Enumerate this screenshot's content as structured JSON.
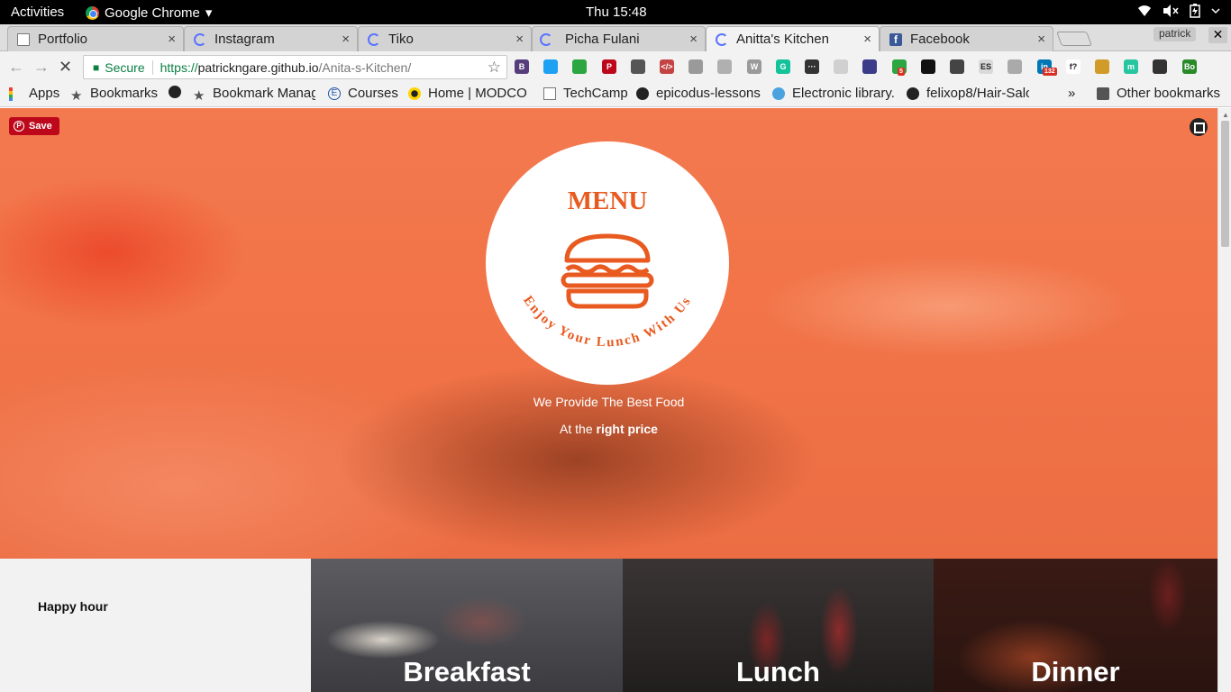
{
  "system_bar": {
    "activities": "Activities",
    "app_name": "Google Chrome",
    "app_menu_arrow": "▾",
    "clock": "Thu 15:48",
    "tray_icons": [
      "wifi-icon",
      "volume-muted-icon",
      "battery-icon",
      "power-menu-icon"
    ]
  },
  "tabs": [
    {
      "label": "Portfolio",
      "icon": "doc"
    },
    {
      "label": "Instagram",
      "icon": "spin"
    },
    {
      "label": "Tiko",
      "icon": "spin"
    },
    {
      "label": "Picha Fulani",
      "icon": "spin"
    },
    {
      "label": "Anitta's Kitchen",
      "icon": "spin",
      "active": true
    },
    {
      "label": "Facebook",
      "icon": "fb"
    }
  ],
  "tab_close_glyph": "×",
  "window": {
    "profile": "patrick",
    "close": "✕"
  },
  "omnibox": {
    "secure_label": "Secure",
    "url_scheme": "https://",
    "url_host": "patrickngare.github.io",
    "url_path": "/Anita-s-Kitchen/"
  },
  "toolbar_glyphs": {
    "back": "←",
    "forward": "→",
    "stop": "✕",
    "lock": "🔒",
    "star": "☆"
  },
  "extensions": [
    {
      "name": "bootstrap",
      "color": "#563d7c",
      "text": "B"
    },
    {
      "name": "twitter",
      "color": "#1da1f2",
      "text": ""
    },
    {
      "name": "ext-green",
      "color": "#2ba640",
      "text": ""
    },
    {
      "name": "pinterest",
      "color": "#bd081c",
      "text": "P"
    },
    {
      "name": "pocket",
      "color": "#555555",
      "text": ""
    },
    {
      "name": "code",
      "color": "#c44444",
      "text": "</>"
    },
    {
      "name": "ext-grey-1",
      "color": "#9a9a9a",
      "text": ""
    },
    {
      "name": "ext-grey-2",
      "color": "#b0b0b0",
      "text": ""
    },
    {
      "name": "wordpress",
      "color": "#9a9a9a",
      "text": "W"
    },
    {
      "name": "grammarly",
      "color": "#15c39a",
      "text": "G"
    },
    {
      "name": "ext-dots",
      "color": "#333333",
      "text": "···"
    },
    {
      "name": "ext-light",
      "color": "#d0d0d0",
      "text": ""
    },
    {
      "name": "bookmark-ext",
      "color": "#3b3b8a",
      "text": ""
    },
    {
      "name": "ext-green-dot",
      "color": "#2ba640",
      "text": "",
      "badge": "5"
    },
    {
      "name": "gnome",
      "color": "#111111",
      "text": ""
    },
    {
      "name": "eyedropper",
      "color": "#444444",
      "text": ""
    },
    {
      "name": "ext-es",
      "color": "#d9d9d9",
      "text": "ES"
    },
    {
      "name": "ext-swirl",
      "color": "#aaaaaa",
      "text": ""
    },
    {
      "name": "linkedin",
      "color": "#0077b5",
      "text": "in",
      "badge": "132"
    },
    {
      "name": "whatfont",
      "color": "#ffffff",
      "text": "f?"
    },
    {
      "name": "ext-tag",
      "color": "#d19b2a",
      "text": ""
    },
    {
      "name": "ext-teal",
      "color": "#26c6a0",
      "text": "m"
    },
    {
      "name": "ext-film",
      "color": "#333333",
      "text": ""
    },
    {
      "name": "ext-bo",
      "color": "#2a8a2a",
      "text": "Bo"
    }
  ],
  "bookmarks": [
    {
      "label": "Apps",
      "icon": "apps"
    },
    {
      "label": "Bookmarks",
      "icon": "star"
    },
    {
      "label": "",
      "icon": "github"
    },
    {
      "label": "Bookmark Manag",
      "icon": "star"
    },
    {
      "label": "Courses",
      "icon": "e"
    },
    {
      "label": "Home | MODCO",
      "icon": "modco"
    },
    {
      "label": "TechCamp",
      "icon": "doc"
    },
    {
      "label": "epicodus-lessons",
      "icon": "github"
    },
    {
      "label": "Electronic library.",
      "icon": "globe"
    },
    {
      "label": "felixop8/Hair-Salo",
      "icon": "github"
    }
  ],
  "bookmarks_overflow": "»",
  "other_bookmarks": "Other bookmarks",
  "hero": {
    "pin_save": "Save",
    "logo_title": "MENU",
    "logo_arc_text": "Enjoy Your Lunch With Us",
    "line1": "We Provide The Best Food",
    "line2_prefix": "At the ",
    "line2_bold": "right price"
  },
  "sections": {
    "happy_hour": "Happy hour",
    "meals": [
      "Breakfast",
      "Lunch",
      "Dinner"
    ]
  },
  "colors": {
    "accent": "#e85a1f",
    "overlay": "#f27448",
    "pinterest": "#bd081c"
  }
}
